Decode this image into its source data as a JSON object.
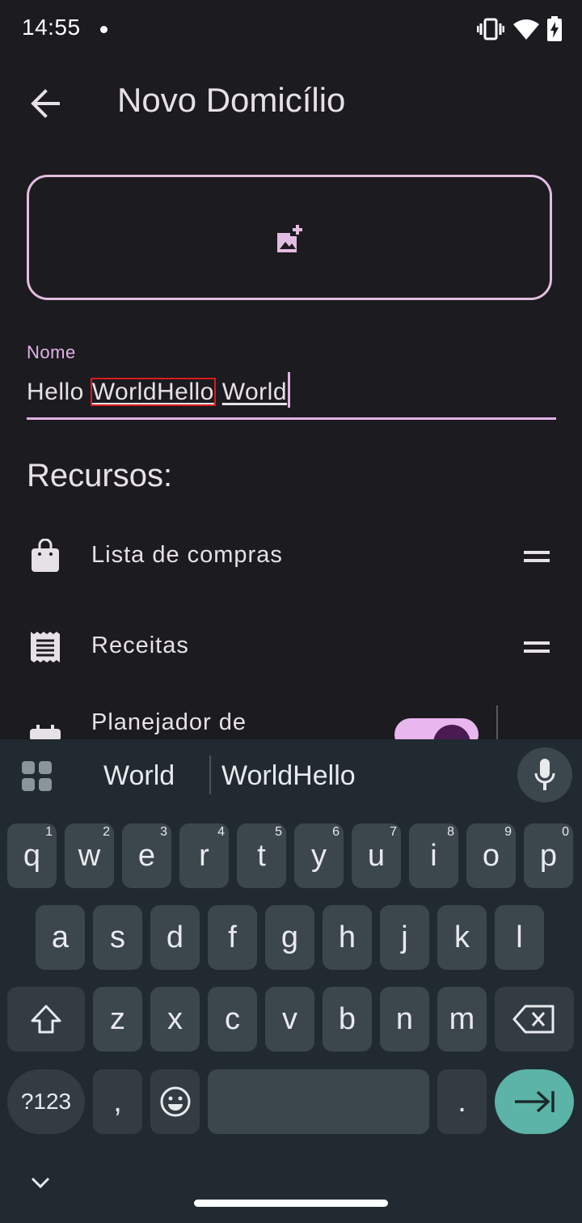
{
  "status_bar": {
    "time": "14:55"
  },
  "app_bar": {
    "title": "Novo Domicílio"
  },
  "name_field": {
    "label": "Nome",
    "value_prefix": "Hello ",
    "value_highlight": "WorldHello",
    "value_suffix": "World"
  },
  "resources": {
    "title": "Recursos:",
    "items": [
      {
        "label": "Lista de compras",
        "icon": "shopping-bag-icon"
      },
      {
        "label": "Receitas",
        "icon": "receipt-icon"
      },
      {
        "label": "Planejador de",
        "icon": "calendar-icon"
      }
    ]
  },
  "keyboard": {
    "suggestions": [
      "World",
      "WorldHello"
    ],
    "row1": [
      {
        "k": "q",
        "n": "1"
      },
      {
        "k": "w",
        "n": "2"
      },
      {
        "k": "e",
        "n": "3"
      },
      {
        "k": "r",
        "n": "4"
      },
      {
        "k": "t",
        "n": "5"
      },
      {
        "k": "y",
        "n": "6"
      },
      {
        "k": "u",
        "n": "7"
      },
      {
        "k": "i",
        "n": "8"
      },
      {
        "k": "o",
        "n": "9"
      },
      {
        "k": "p",
        "n": "0"
      }
    ],
    "row2": [
      "a",
      "s",
      "d",
      "f",
      "g",
      "h",
      "j",
      "k",
      "l"
    ],
    "row3": [
      "z",
      "x",
      "c",
      "v",
      "b",
      "n",
      "m"
    ],
    "symbols_label": "?123",
    "comma": ",",
    "period": "."
  }
}
